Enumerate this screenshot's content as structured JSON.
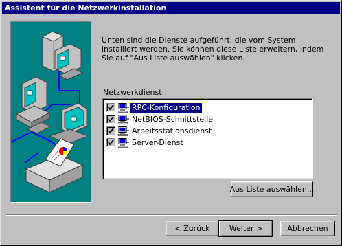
{
  "window": {
    "title": "Assistent für die Netzwerkinstallation"
  },
  "description": "Unten sind die Dienste aufgeführt, die vom System installiert werden. Sie können diese Liste erweitern, indem Sie auf \"Aus Liste auswählen\" klicken.",
  "list": {
    "label": "Netzwerkdienst:",
    "items": [
      {
        "label": "RPC-Konfiguration",
        "checked": true,
        "selected": true,
        "icon": "network-service-icon"
      },
      {
        "label": "NetBIOS-Schnittstelle",
        "checked": true,
        "selected": false,
        "icon": "network-service-icon"
      },
      {
        "label": "Arbeitsstationsdienst",
        "checked": true,
        "selected": false,
        "icon": "network-service-icon"
      },
      {
        "label": "Server-Dienst",
        "checked": true,
        "selected": false,
        "icon": "network-service-icon"
      }
    ]
  },
  "buttons": {
    "select_from_list": "Aus Liste auswählen...",
    "back": "< Zurück",
    "next": "Weiter >",
    "cancel": "Abbrechen"
  },
  "colors": {
    "titlebar": "#000080",
    "illustration_bg": "#008080",
    "selection": "#000080"
  }
}
